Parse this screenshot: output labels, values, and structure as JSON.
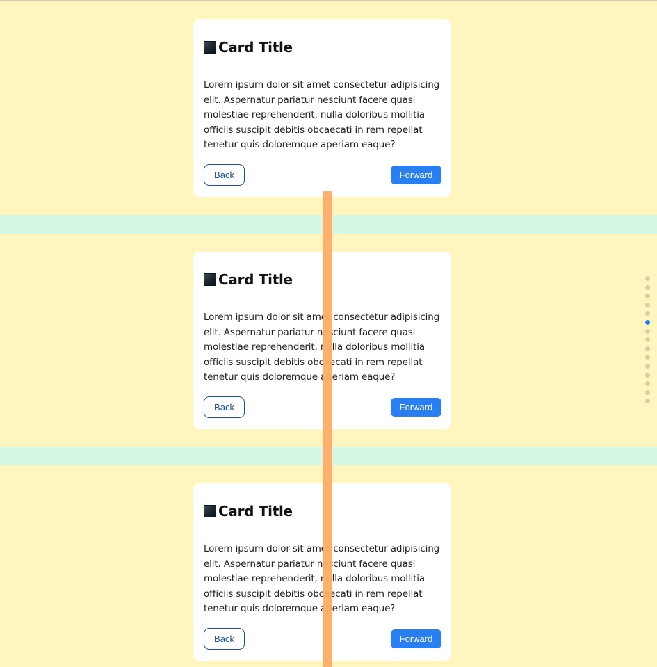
{
  "cards": [
    {
      "title": "Card Title",
      "body": "Lorem ipsum dolor sit amet consectetur adipisicing elit. Aspernatur pariatur nesciunt facere quasi molestiae reprehenderit, nulla doloribus mollitia officiis suscipit debitis obcaecati in rem repellat tenetur quis doloremque aperiam eaque?",
      "back_label": "Back",
      "forward_label": "Forward"
    },
    {
      "title": "Card Title",
      "body": "Lorem ipsum dolor sit amet consectetur adipisicing elit. Aspernatur pariatur nesciunt facere quasi molestiae reprehenderit, nulla doloribus mollitia officiis suscipit debitis obcaecati in rem repellat tenetur quis doloremque aperiam eaque?",
      "back_label": "Back",
      "forward_label": "Forward"
    },
    {
      "title": "Card Title",
      "body": "Lorem ipsum dolor sit amet consectetur adipisicing elit. Aspernatur pariatur nesciunt facere quasi molestiae reprehenderit, nulla doloribus mollitia officiis suscipit debitis obcaecati in rem repellat tenetur quis doloremque aperiam eaque?",
      "back_label": "Back",
      "forward_label": "Forward"
    }
  ],
  "overlay_mark": "..",
  "pager": {
    "total": 15,
    "active_index": 5
  },
  "colors": {
    "page_background": "#fff5bf",
    "separator_band": "#d6f8e2",
    "accent_blue": "#2a7ff0",
    "back_border": "#1d4fa0",
    "overlay_bar": "#fdae6b"
  }
}
